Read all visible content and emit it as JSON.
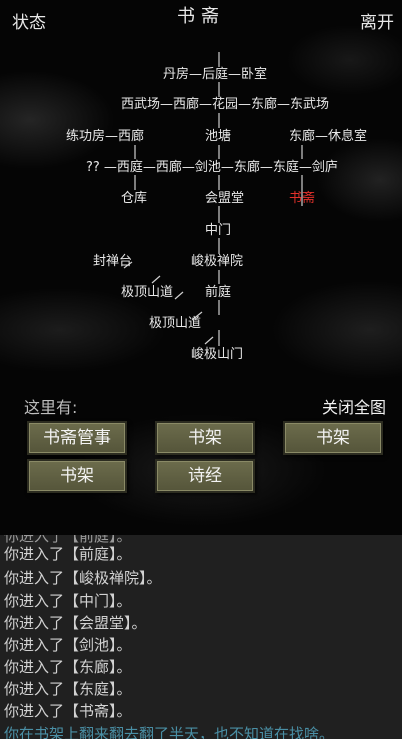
{
  "header": {
    "status": "状态",
    "title": "书斋",
    "leave": "离开"
  },
  "map": {
    "rooms": {
      "r1": "丹房—后庭—卧室",
      "r2": "西武场—西廊—花园—东廊—东武场",
      "r3a": "练功房—西廊",
      "r3b": "池塘",
      "r3c": "东廊—休息室",
      "r4": "?? —西庭—西廊—剑池—东廊—东庭—剑庐",
      "r5a": "仓库",
      "r5b": "会盟堂",
      "r5c": "书斋",
      "r6": "中门",
      "r7a": "封禅台",
      "r7b": "峻极禅院",
      "r8a": "极顶山道",
      "r8b": "前庭",
      "r9": "极顶山道",
      "r10": "峻极山门"
    }
  },
  "here": {
    "label": "这里有:",
    "close_map": "关闭全图"
  },
  "actions": [
    "书斋管事",
    "书架",
    "书架",
    "书架",
    "诗经"
  ],
  "log": [
    "你进入了【前庭】。",
    "你进入了【峻极禅院】。",
    "你进入了【中门】。",
    "你进入了【会盟堂】。",
    "你进入了【剑池】。",
    "你进入了【东廊】。",
    "你进入了【东庭】。",
    "你进入了【书斋】。",
    "你在书架上翻来翻去翻了半天，也不知道在找啥。"
  ],
  "colors": {
    "current_room": "#e0302a",
    "log_highlight": "#4a8fa5",
    "button": "#62624a"
  }
}
